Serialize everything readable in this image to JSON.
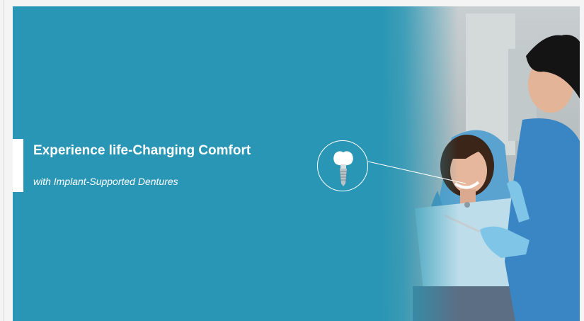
{
  "banner": {
    "headline": "Experience life-Changing Comfort",
    "subheadline": "with Implant-Supported Dentures",
    "background_color": "#2896b4",
    "text_color": "#ffffff"
  },
  "illustration": {
    "callout_icon": "dental-implant-icon",
    "photo_subject": "dental-patient-photo"
  }
}
